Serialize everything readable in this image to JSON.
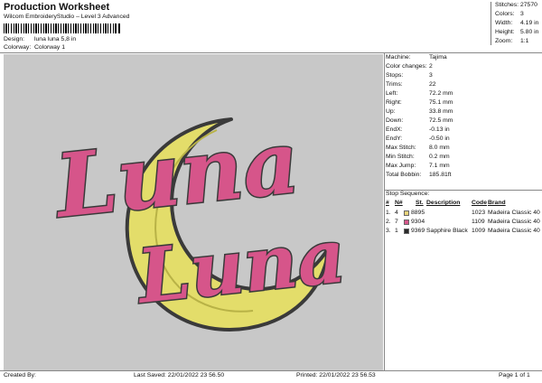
{
  "header": {
    "title": "Production Worksheet",
    "software": "Wilcom EmbroideryStudio – Level 3 Advanced",
    "design_label": "Design:",
    "design_value": "luna luna 5,8 in",
    "colorway_label": "Colorway:",
    "colorway_value": "Colorway 1"
  },
  "top_stats": [
    {
      "label": "Stitches:",
      "value": "27570"
    },
    {
      "label": "Colors:",
      "value": "3"
    },
    {
      "label": "Width:",
      "value": "4.19 in"
    },
    {
      "label": "Height:",
      "value": "5.80 in"
    },
    {
      "label": "Zoom:",
      "value": "1:1"
    }
  ],
  "design_text": [
    "Luna",
    "Luna"
  ],
  "info": [
    {
      "label": "Machine:",
      "value": "Tajima"
    },
    {
      "label": "Color changes:",
      "value": "2"
    },
    {
      "label": "Stops:",
      "value": "3"
    },
    {
      "label": "Trims:",
      "value": "22"
    },
    {
      "label": "Left:",
      "value": "72.2 mm"
    },
    {
      "label": "Right:",
      "value": "75.1 mm"
    },
    {
      "label": "Up:",
      "value": "33.8 mm"
    },
    {
      "label": "Down:",
      "value": "72.5 mm"
    },
    {
      "label": "EndX:",
      "value": "-0.13 in"
    },
    {
      "label": "EndY:",
      "value": "-0.50 in"
    },
    {
      "label": "Max Stitch:",
      "value": "8.0 mm"
    },
    {
      "label": "Min Stitch:",
      "value": "0.2 mm"
    },
    {
      "label": "Max Jump:",
      "value": "7.1 mm"
    },
    {
      "label": "Total Bobbin:",
      "value": "185.81ft"
    }
  ],
  "sequence": {
    "title": "Stop Sequence:",
    "columns": [
      "#",
      "N#",
      "St.",
      "Description",
      "Code",
      "Brand"
    ],
    "rows": [
      {
        "num": "1.",
        "needle": "4",
        "color": "#e6d27a",
        "st": "8895",
        "description": "",
        "code": "1023",
        "brand": "Madeira Classic 40"
      },
      {
        "num": "2.",
        "needle": "7",
        "color": "#d6558a",
        "st": "9304",
        "description": "",
        "code": "1109",
        "brand": "Madeira Classic 40"
      },
      {
        "num": "3.",
        "needle": "1",
        "color": "#2a2a2a",
        "st": "9369",
        "description": "Sapphire Black",
        "code": "1009",
        "brand": "Madeira Classic 40"
      }
    ]
  },
  "footer": {
    "created_by": "Created By:",
    "last_saved": "Last Saved: 22/01/2022 23 56.50",
    "printed": "Printed: 22/01/2022 23 56.53",
    "page": "Page 1 of 1"
  },
  "colors": {
    "canvas_bg": "#c8c8c8",
    "moon_fill": "#e3dd6a",
    "moon_outline": "#3a3a3a",
    "text_fill": "#d6558a"
  }
}
